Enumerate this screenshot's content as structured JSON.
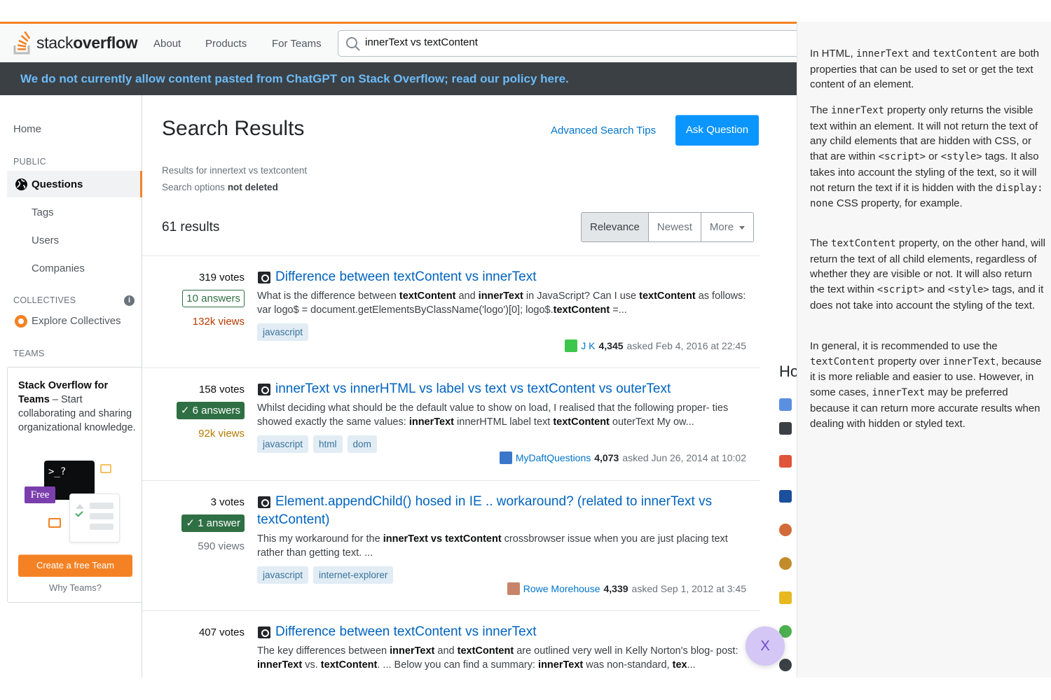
{
  "topbar": {
    "logo": {
      "word1": "stack",
      "word2": "overflow"
    },
    "nav": [
      "About",
      "Products",
      "For Teams"
    ],
    "search_value": "innerText vs textContent",
    "search_icon": "search-icon"
  },
  "banner": {
    "text": "We do not currently allow content pasted from ChatGPT on Stack Overflow; read our policy here."
  },
  "sidebar": {
    "home": "Home",
    "public_heading": "PUBLIC",
    "questions": "Questions",
    "tags": "Tags",
    "users": "Users",
    "companies": "Companies",
    "collectives_heading": "COLLECTIVES",
    "explore_collectives": "Explore Collectives",
    "teams_heading": "TEAMS",
    "teams_card": {
      "title": "Stack Overflow for Teams",
      "text": " – Start collaborating and sharing organizational knowledge.",
      "free_badge": "Free",
      "terminal_text": ">_?",
      "button": "Create a free Team",
      "why": "Why Teams?"
    }
  },
  "main": {
    "title": "Search Results",
    "advanced_tips": "Advanced Search Tips",
    "ask_button": "Ask Question",
    "results_for": "Results for innertext vs textcontent",
    "search_options_prefix": "Search options ",
    "search_options_value": "not deleted",
    "result_count": "61 results",
    "filters": [
      {
        "label": "Relevance",
        "selected": true
      },
      {
        "label": "Newest",
        "selected": false
      },
      {
        "label": "More",
        "selected": false
      }
    ]
  },
  "questions": [
    {
      "votes": "319 votes",
      "answers": "10 answers",
      "accepted": false,
      "views": "132k views",
      "views_color": "#b93a00",
      "title": "Difference between textContent vs innerText",
      "excerpt_html": "What is the difference between <b>textContent</b> and <b>innerText</b> in JavaScript? Can I use <b>textContent</b> as follows: var logo$ = document.getElementsByClassName('logo')[0]; logo$.<b>textContent</b> =...",
      "tags": [
        "javascript"
      ],
      "user": "J K",
      "rep": "4,345",
      "asked": "asked Feb 4, 2016 at 22:45",
      "avatar_color": "#3ec64c"
    },
    {
      "votes": "158 votes",
      "answers": "6 answers",
      "accepted": true,
      "views": "92k views",
      "views_color": "#b47b00",
      "title": "innerText vs innerHTML vs label vs text vs textContent vs outerText",
      "excerpt_html": "Whilst deciding what should be the default value to show on load, I realised that the following proper- ties showed exactly the same values: <b>innerText</b> innerHTML label text <b>textContent</b> outerText My ow...",
      "tags": [
        "javascript",
        "html",
        "dom"
      ],
      "user": "MyDaftQuestions",
      "rep": "4,073",
      "asked": "asked Jun 26, 2014 at 10:02",
      "avatar_color": "#3a76c9"
    },
    {
      "votes": "3 votes",
      "answers": "1 answer",
      "accepted": true,
      "views": "590 views",
      "views_color": "#6a737c",
      "title": "Element.appendChild() hosed in IE .. workaround? (related to innerText vs textContent)",
      "excerpt_html": "This my workaround for the <b>innerText vs textContent</b> crossbrowser issue when you are just placing text rather than getting text. ...",
      "tags": [
        "javascript",
        "internet-explorer"
      ],
      "user": "Rowe Morehouse",
      "rep": "4,339",
      "asked": "asked Sep 1, 2012 at 3:45",
      "avatar_color": "#c7846a"
    },
    {
      "votes": "407 votes",
      "title": "Difference between textContent vs innerText",
      "excerpt_html": "The key differences between <b>innerText</b> and <b>textContent</b> are outlined very well in Kelly Norton's blog- post: <b>innerText</b> vs. <b>textContent</b>. ... Below you can find a summary: <b>innerText</b> was non-standard, <b>tex</b>..."
    }
  ],
  "right_panel": {
    "paragraphs_html": [
      "In HTML, <code>innerText</code> and <code>textContent</code> are both properties that can be used to set or get the text content of an element.",
      "The <code>innerText</code> property only returns the visible text within an element. It will not return the text of any child elements that are hidden with CSS, or that are within <code>&lt;script&gt;</code> or <code>&lt;style&gt;</code> tags. It also takes into account the styling of the text, so it will not return the text if it is hidden with the <code>display: none</code> CSS property, for example.",
      "The <code>textContent</code> property, on the other hand, will return the text of all child elements, regardless of whether they are visible or not. It will also return the text within <code>&lt;script&gt;</code> and <code>&lt;style&gt;</code> tags, and it does not take into account the styling of the text.",
      "In general, it is recommended to use the <code>textContent</code> property over <code>innerText</code>, because it is more reliable and easier to use. However, in some cases, <code>innerText</code> may be preferred because it can return more accurate results when dealing with hidden or styled text."
    ]
  },
  "strip": {
    "heading": "Ho",
    "icon_colors": [
      "#5b8fe0",
      "#3b4045",
      "#e0543a",
      "#1c4f9c",
      "#d26b3a",
      "#c28b2b",
      "#e8b821",
      "#4caf50",
      "#3b4045"
    ]
  },
  "close_fab": "X",
  "colors": {
    "accent": "#f48225",
    "link": "#0074cc",
    "button": "#0a95ff",
    "banner_bg": "#3b4045",
    "banner_text": "#6cbbf7"
  }
}
